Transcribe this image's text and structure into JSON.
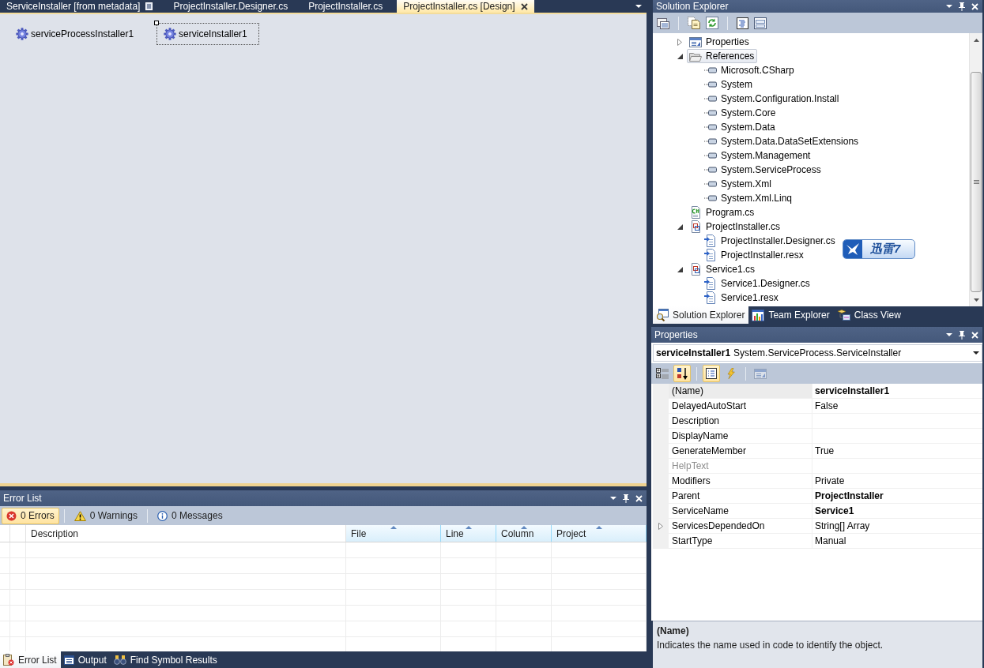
{
  "document_tabs": [
    {
      "label": "ServiceInstaller [from metadata]",
      "kind": "metadata",
      "selected": false
    },
    {
      "label": "ProjectInstaller.Designer.cs",
      "kind": "file",
      "selected": false
    },
    {
      "label": "ProjectInstaller.cs",
      "kind": "file",
      "selected": false
    },
    {
      "label": "ProjectInstaller.cs [Design]",
      "kind": "file",
      "selected": true
    }
  ],
  "designer": {
    "components": [
      {
        "label": "serviceProcessInstaller1",
        "selected": false
      },
      {
        "label": "serviceInstaller1",
        "selected": true
      }
    ]
  },
  "error_list": {
    "title": "Error List",
    "filters": [
      {
        "label": "0 Errors",
        "kind": "error",
        "selected": true
      },
      {
        "label": "0 Warnings",
        "kind": "warning",
        "selected": false
      },
      {
        "label": "0 Messages",
        "kind": "info",
        "selected": false
      }
    ],
    "columns": [
      {
        "sort_arrow": false
      },
      {
        "sort_arrow": false
      },
      {
        "label": "Description",
        "sort_arrow": false
      },
      {
        "label": "File",
        "sort_arrow": true
      },
      {
        "label": "Line",
        "sort_arrow": true
      },
      {
        "label": "Column",
        "sort_arrow": true
      },
      {
        "label": "Project",
        "sort_arrow": true
      }
    ]
  },
  "bottom_tabs": [
    {
      "label": "Error List",
      "kind": "error-list",
      "selected": true
    },
    {
      "label": "Output",
      "kind": "output",
      "selected": false
    },
    {
      "label": "Find Symbol Results",
      "kind": "find-symbol",
      "selected": false
    }
  ],
  "solution_explorer": {
    "title": "Solution Explorer",
    "tree": [
      {
        "label": "Properties",
        "kind": "properties",
        "expanded": false,
        "selected": false
      },
      {
        "label": "References",
        "kind": "folder",
        "expanded": true,
        "selected": true,
        "children": [
          {
            "label": "Microsoft.CSharp",
            "kind": "reference",
            "selected": false
          },
          {
            "label": "System",
            "kind": "reference",
            "selected": false
          },
          {
            "label": "System.Configuration.Install",
            "kind": "reference",
            "selected": false
          },
          {
            "label": "System.Core",
            "kind": "reference",
            "selected": false
          },
          {
            "label": "System.Data",
            "kind": "reference",
            "selected": false
          },
          {
            "label": "System.Data.DataSetExtensions",
            "kind": "reference",
            "selected": false
          },
          {
            "label": "System.Management",
            "kind": "reference",
            "selected": false
          },
          {
            "label": "System.ServiceProcess",
            "kind": "reference",
            "selected": false
          },
          {
            "label": "System.Xml",
            "kind": "reference",
            "selected": false
          },
          {
            "label": "System.Xml.Linq",
            "kind": "reference",
            "selected": false
          }
        ]
      },
      {
        "label": "Program.cs",
        "kind": "csharp",
        "selected": false
      },
      {
        "label": "ProjectInstaller.cs",
        "kind": "component",
        "expanded": true,
        "selected": false,
        "children": [
          {
            "label": "ProjectInstaller.Designer.cs",
            "kind": "dependent",
            "selected": false
          },
          {
            "label": "ProjectInstaller.resx",
            "kind": "dependent",
            "selected": false
          }
        ]
      },
      {
        "label": "Service1.cs",
        "kind": "component",
        "expanded": true,
        "selected": false,
        "children": [
          {
            "label": "Service1.Designer.cs",
            "kind": "dependent",
            "selected": false
          },
          {
            "label": "Service1.resx",
            "kind": "dependent",
            "selected": false
          }
        ]
      }
    ],
    "tabs": [
      {
        "label": "Solution Explorer",
        "kind": "solution",
        "selected": true
      },
      {
        "label": "Team Explorer",
        "kind": "team",
        "selected": false
      },
      {
        "label": "Class View",
        "kind": "class",
        "selected": false
      }
    ]
  },
  "floating_badge": {
    "label": "迅雷7"
  },
  "properties": {
    "title": "Properties",
    "object_name": "serviceInstaller1",
    "object_type": "System.ServiceProcess.ServiceInstaller",
    "toolbar": [
      {
        "kind": "categorized",
        "selected": false,
        "disabled": false
      },
      {
        "kind": "alphabetical",
        "selected": true,
        "disabled": false
      },
      {
        "kind": "properties",
        "selected": true,
        "disabled": false
      },
      {
        "kind": "events",
        "selected": false,
        "disabled": false
      },
      {
        "kind": "property-pages",
        "selected": false,
        "disabled": true
      }
    ],
    "rows": [
      {
        "name": "(Name)",
        "value": "serviceInstaller1",
        "bold": true,
        "disabled": false,
        "selected": true
      },
      {
        "name": "DelayedAutoStart",
        "value": "False",
        "bold": false,
        "disabled": false,
        "selected": false
      },
      {
        "name": "Description",
        "disabled": false,
        "selected": false
      },
      {
        "name": "DisplayName",
        "disabled": false,
        "selected": false
      },
      {
        "name": "GenerateMember",
        "value": "True",
        "bold": false,
        "disabled": false,
        "selected": false
      },
      {
        "name": "HelpText",
        "disabled": true,
        "selected": false
      },
      {
        "name": "Modifiers",
        "value": "Private",
        "bold": false,
        "disabled": false,
        "selected": false
      },
      {
        "name": "Parent",
        "value": "ProjectInstaller",
        "bold": true,
        "disabled": false,
        "selected": false
      },
      {
        "name": "ServiceName",
        "value": "Service1",
        "bold": true,
        "disabled": false,
        "selected": false
      },
      {
        "name": "ServicesDependedOn",
        "value": "String[] Array",
        "bold": false,
        "disabled": false,
        "selected": false,
        "expanded": false
      },
      {
        "name": "StartType",
        "value": "Manual",
        "bold": false,
        "disabled": false,
        "selected": false
      }
    ],
    "description": {
      "title": "(Name)",
      "text": "Indicates the name used in code to identify the object."
    }
  }
}
